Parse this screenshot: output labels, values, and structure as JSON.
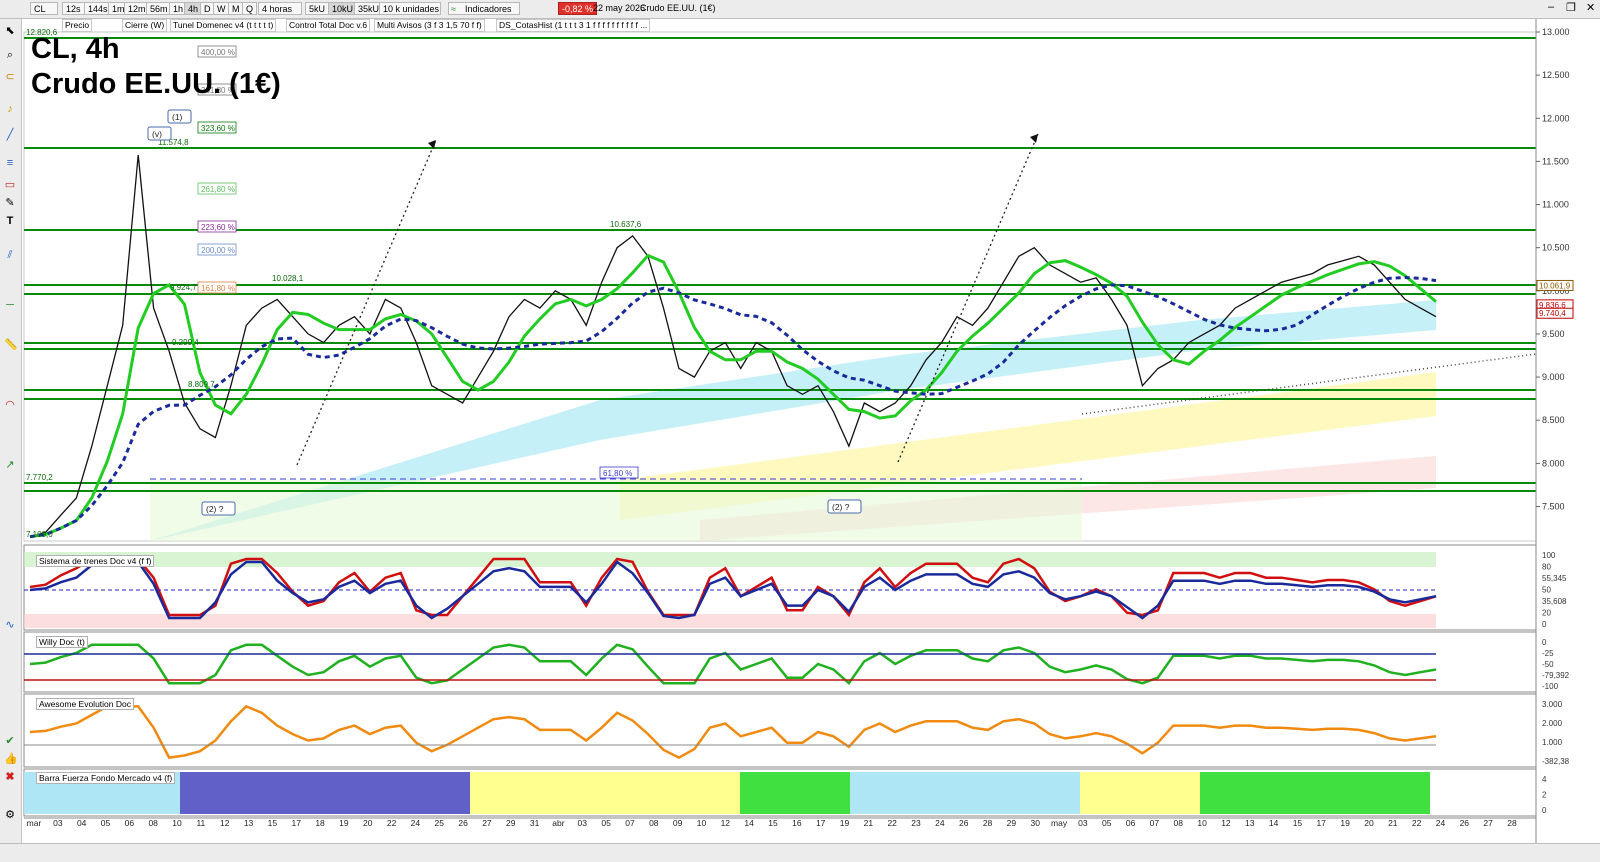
{
  "toolbar": {
    "symbol": "CL",
    "timeframes": [
      "12s",
      "144s",
      "1m",
      "12m",
      "56m",
      "1h",
      "4h",
      "D",
      "W",
      "M",
      "Q"
    ],
    "active_timeframe": "4h",
    "period_select": "4 horas",
    "units_options": [
      "5kU",
      "10kU",
      "35kU"
    ],
    "active_units": "10kU",
    "units_select": "10 k unidades",
    "indicators_label": "Indicadores",
    "change_badge": "-0,82 %",
    "date_text": "22 may 2026",
    "instrument_text": "Crudo EE.UU. (1€)"
  },
  "legend_items": [
    "Precio",
    "Cierre (W)",
    "Tunel Domenec v4 (t t t t t)",
    "Control Total Doc v.6",
    "Multi Avisos (3 f 3 1,5 70 f f)",
    "DS_CotasHist (1 t t t 3 1 f f f f f f f f f f ..."
  ],
  "chart_title": {
    "line1": "CL, 4h",
    "line2": "Crudo EE.UU. (1€)"
  },
  "price_axis": {
    "ticks": [
      "13.000",
      "12.500",
      "12.000",
      "11.500",
      "11.000",
      "10.500",
      "10.000",
      "9.500",
      "9.000",
      "8.500",
      "8.000",
      "7.500"
    ],
    "tick_values": [
      13000,
      12500,
      12000,
      11500,
      11000,
      10500,
      10000,
      9500,
      9000,
      8500,
      8000,
      7500
    ],
    "price_tags": [
      {
        "text": "10.061,9",
        "value": 10062,
        "color": "#8a5a00"
      },
      {
        "text": "9.836,6",
        "value": 9837,
        "color": "#c00000"
      },
      {
        "text": "9.740,4",
        "value": 9740,
        "color": "#c00000"
      }
    ]
  },
  "fib_levels": [
    {
      "text": "400,00 %",
      "color": "#777777"
    },
    {
      "text": "361,80 %",
      "color": "#777777"
    },
    {
      "text": "323,60 %",
      "color": "#0a7a0a"
    },
    {
      "text": "261,80 %",
      "color": "#5ec05e"
    },
    {
      "text": "223,60 %",
      "color": "#8a2a9a"
    },
    {
      "text": "200,00 %",
      "color": "#6a8ac8"
    },
    {
      "text": "161,80 %",
      "color": "#e08040"
    },
    {
      "text": "61,80 %",
      "color": "#3a3ad0"
    }
  ],
  "level_labels": [
    "12.820,6",
    "11.574,8",
    "10.637,6",
    "10.028,1",
    "9.924,7",
    "9.299,4",
    "8.809,7",
    "7.770,2",
    "7.109,0"
  ],
  "wave_labels": [
    "(v)",
    "(1)",
    "(2) ?",
    "(2) ?"
  ],
  "chart_data": {
    "type": "line",
    "series": [
      {
        "values": [
          7150,
          7200,
          7400,
          7600,
          8200,
          8900,
          9600,
          11574,
          9800,
          9300,
          8700,
          8400,
          8300,
          8900,
          9600,
          9800,
          9900,
          9700,
          9500,
          9400,
          9600,
          9700,
          9500,
          9900,
          9800,
          9400,
          8900,
          8800,
          8700,
          9000,
          9300,
          9700,
          9900,
          9800,
          10000,
          9900,
          9600,
          10100,
          10500,
          10637,
          10400,
          9800,
          9100,
          9000,
          9300,
          9400,
          9100,
          9400,
          9300,
          8900,
          8800,
          8900,
          8600,
          8200,
          8700,
          8600,
          8700,
          8900,
          9200,
          9400,
          9700,
          9600,
          9800,
          10100,
          10400,
          10500,
          10300,
          10200,
          10100,
          10150,
          9900,
          9600,
          8900,
          9100,
          9200,
          9400,
          9500,
          9600,
          9800,
          9900,
          10000,
          10100,
          10150,
          10200,
          10300,
          10350,
          10400,
          10300,
          10100,
          9900,
          9800,
          9700
        ]
      }
    ],
    "x_ticks": [
      "mar",
      "03",
      "04",
      "05",
      "06",
      "08",
      "10",
      "11",
      "12",
      "13",
      "15",
      "17",
      "18",
      "19",
      "20",
      "22",
      "24",
      "25",
      "26",
      "27",
      "29",
      "31",
      "abr",
      "03",
      "05",
      "07",
      "08",
      "09",
      "10",
      "12",
      "14",
      "15",
      "16",
      "17",
      "19",
      "21",
      "22",
      "23",
      "24",
      "26",
      "28",
      "29",
      "30",
      "may",
      "03",
      "05",
      "06",
      "07",
      "08",
      "10",
      "12",
      "13",
      "14",
      "15",
      "17",
      "19",
      "20",
      "21",
      "22",
      "24",
      "26",
      "27",
      "28"
    ],
    "ylim": [
      7100,
      13000
    ]
  },
  "panels": [
    {
      "title": "Sistema de trenes Doc v4 (f f)",
      "ticks": [
        "100",
        "80",
        "55,345",
        "50",
        "35,608",
        "20",
        "0"
      ]
    },
    {
      "title": "Willy Doc (t)",
      "ticks": [
        "0",
        "-25",
        "-50",
        "-79,392",
        "-100"
      ]
    },
    {
      "title": "Awesome Evolution Doc",
      "ticks": [
        "3.000",
        "2.000",
        "1.000",
        "-382,38"
      ]
    },
    {
      "title": "Barra Fuerza Fondo Mercado v4 (f)",
      "ticks": [
        "4",
        "2",
        "0"
      ]
    }
  ]
}
